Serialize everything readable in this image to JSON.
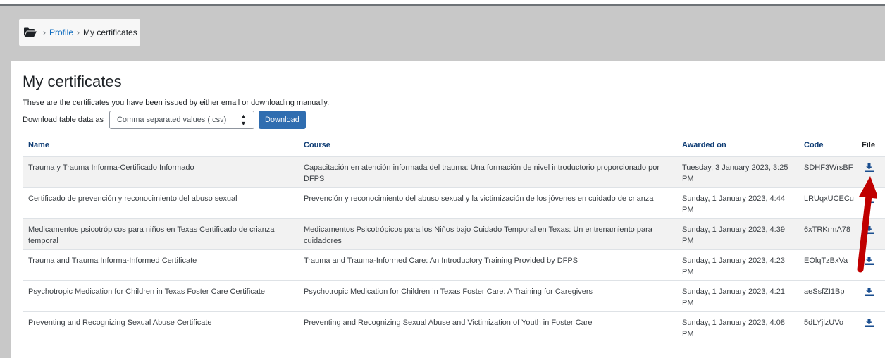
{
  "breadcrumb": {
    "items": [
      "Profile",
      "My certificates"
    ],
    "separator": "›"
  },
  "page": {
    "title": "My certificates",
    "intro": "These are the certificates you have been issued by either email or downloading manually."
  },
  "download": {
    "label": "Download table data as",
    "format_selected": "Comma separated values (.csv)",
    "button_label": "Download"
  },
  "table": {
    "headers": {
      "name": "Name",
      "course": "Course",
      "awarded": "Awarded on",
      "code": "Code",
      "file": "File"
    },
    "rows": [
      {
        "name": "Trauma y Trauma Informa-Certificado Informado",
        "course": "Capacitación en atención informada del trauma: Una formación de nivel introductorio proporcionado por DFPS",
        "awarded": "Tuesday, 3 January 2023, 3:25 PM",
        "code": "SDHF3WrsBF"
      },
      {
        "name": "Certificado de prevención y reconocimiento del abuso sexual",
        "course": "Prevención y reconocimiento del abuso sexual y la victimización de los jóvenes en cuidado de crianza",
        "awarded": "Sunday, 1 January 2023, 4:44 PM",
        "code": "LRUqxUCECu"
      },
      {
        "name": "Medicamentos psicotrópicos para niños en Texas Certificado de crianza temporal",
        "course": "Medicamentos Psicotrópicos para los Niños bajo Cuidado Temporal en Texas: Un entrenamiento para cuidadores",
        "awarded": "Sunday, 1 January 2023, 4:39 PM",
        "code": "6xTRKrmA78"
      },
      {
        "name": "Trauma and Trauma Informa-Informed Certificate",
        "course": "Trauma and Trauma-Informed Care: An Introductory Training Provided by DFPS",
        "awarded": "Sunday, 1 January 2023, 4:23 PM",
        "code": "EOlqTzBxVa"
      },
      {
        "name": "Psychotropic Medication for Children in Texas Foster Care Certificate",
        "course": "Psychotropic Medication for Children in Texas Foster Care: A Training for Caregivers",
        "awarded": "Sunday, 1 January 2023, 4:21 PM",
        "code": "aeSsfZI1Bp"
      },
      {
        "name": "Preventing and Recognizing Sexual Abuse Certificate",
        "course": "Preventing and Recognizing Sexual Abuse and Victimization of Youth in Foster Care",
        "awarded": "Sunday, 1 January 2023, 4:08 PM",
        "code": "5dLYjlzUVo"
      }
    ]
  },
  "icons": {
    "breadcrumb_home": "folder-open-icon",
    "file": "download-icon",
    "annotation": "red-arrow-icon"
  },
  "colors": {
    "link": "#0f6cbf",
    "header_text": "#0f3d75",
    "button": "#2f6db0",
    "icon": "#1a4e8f",
    "arrow": "#c00000",
    "stripe": "#f2f2f2",
    "backdrop": "#c8c8c8"
  }
}
